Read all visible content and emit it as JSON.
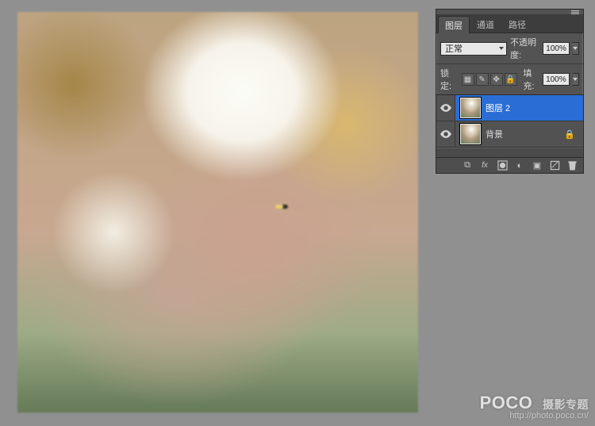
{
  "panel": {
    "tabs": [
      {
        "label": "图层",
        "active": true
      },
      {
        "label": "通道",
        "active": false
      },
      {
        "label": "路径",
        "active": false
      }
    ],
    "blend_mode": "正常",
    "opacity_label": "不透明度:",
    "opacity_value": "100%",
    "lock_label": "锁定:",
    "lock_icons": [
      "transparency",
      "brush",
      "move",
      "all"
    ],
    "fill_label": "填充:",
    "fill_value": "100%",
    "layers": [
      {
        "name": "图层 2",
        "visible": true,
        "selected": true,
        "locked": false
      },
      {
        "name": "背景",
        "visible": true,
        "selected": false,
        "locked": true
      }
    ],
    "bottom_icons": [
      "link",
      "fx",
      "mask",
      "adjust",
      "group",
      "new",
      "trash"
    ]
  },
  "watermark": {
    "brand": "POCO",
    "suffix": "摄影专题",
    "url": "http://photo.poco.cn/"
  }
}
